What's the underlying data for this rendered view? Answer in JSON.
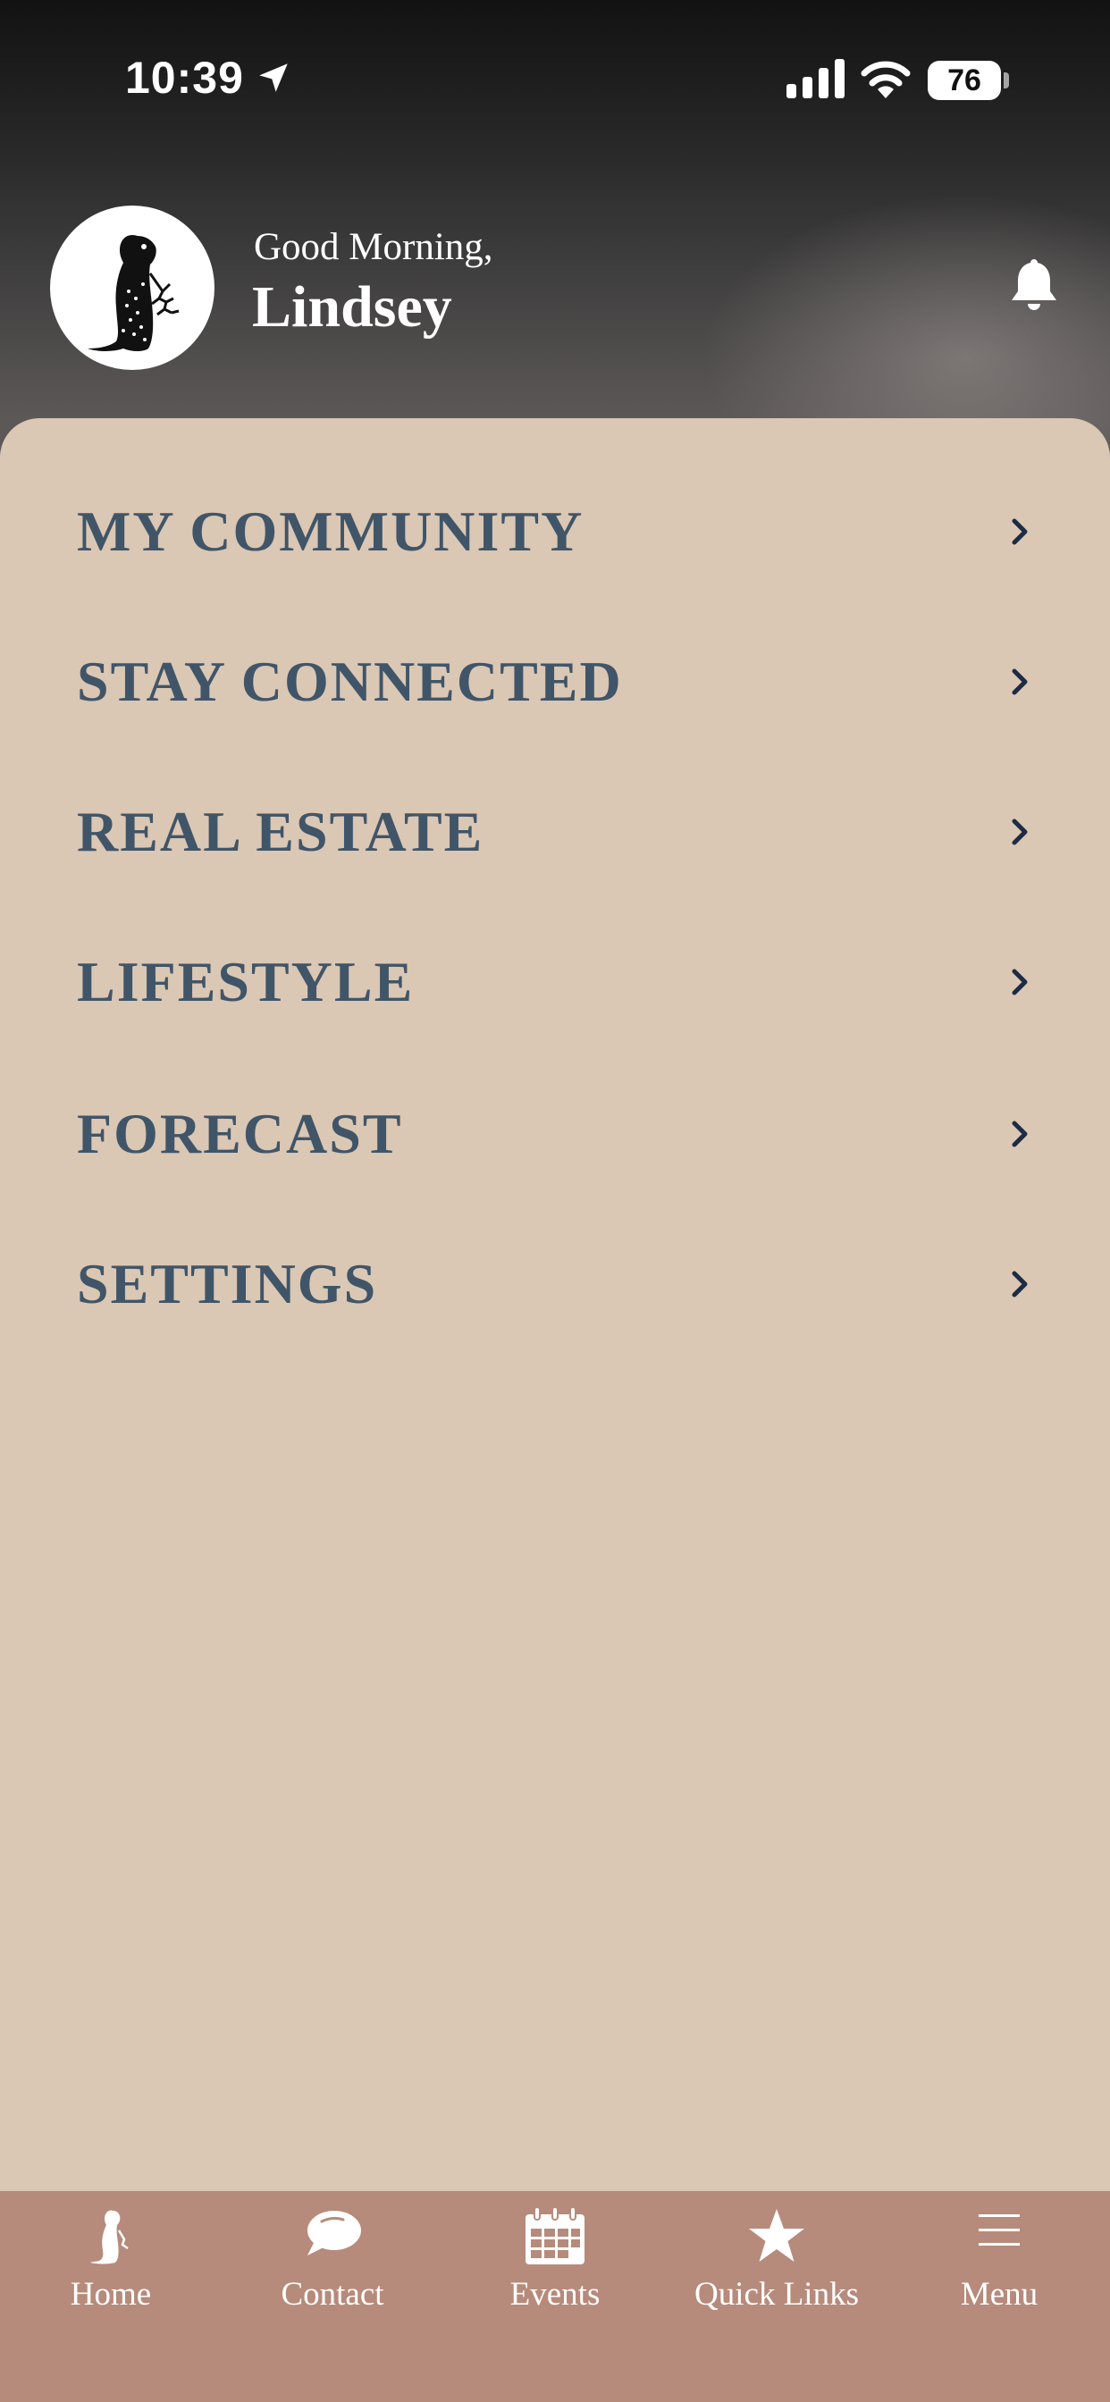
{
  "status_bar": {
    "time": "10:39",
    "battery": "76"
  },
  "header": {
    "greeting": "Good Morning,",
    "user_name": "Lindsey",
    "avatar_icon": "prairie-dog-logo-icon",
    "notification_icon": "bell-icon"
  },
  "menu": {
    "items": [
      {
        "label": "MY COMMUNITY"
      },
      {
        "label": "STAY CONNECTED"
      },
      {
        "label": "REAL ESTATE"
      },
      {
        "label": "LIFESTYLE"
      },
      {
        "label": "FORECAST"
      },
      {
        "label": "SETTINGS"
      }
    ]
  },
  "tabbar": {
    "tabs": [
      {
        "label": "Home",
        "icon": "prairie-dog-icon"
      },
      {
        "label": "Contact",
        "icon": "chat-bubble-icon"
      },
      {
        "label": "Events",
        "icon": "calendar-icon"
      },
      {
        "label": "Quick Links",
        "icon": "star-icon"
      },
      {
        "label": "Menu",
        "icon": "hamburger-icon"
      }
    ]
  },
  "colors": {
    "header_dark": "#1a1a1a",
    "panel_beige": "#dac7b4",
    "menu_text": "#405568",
    "tabbar": "#b68b7b",
    "chevron": "#1d2c44"
  }
}
